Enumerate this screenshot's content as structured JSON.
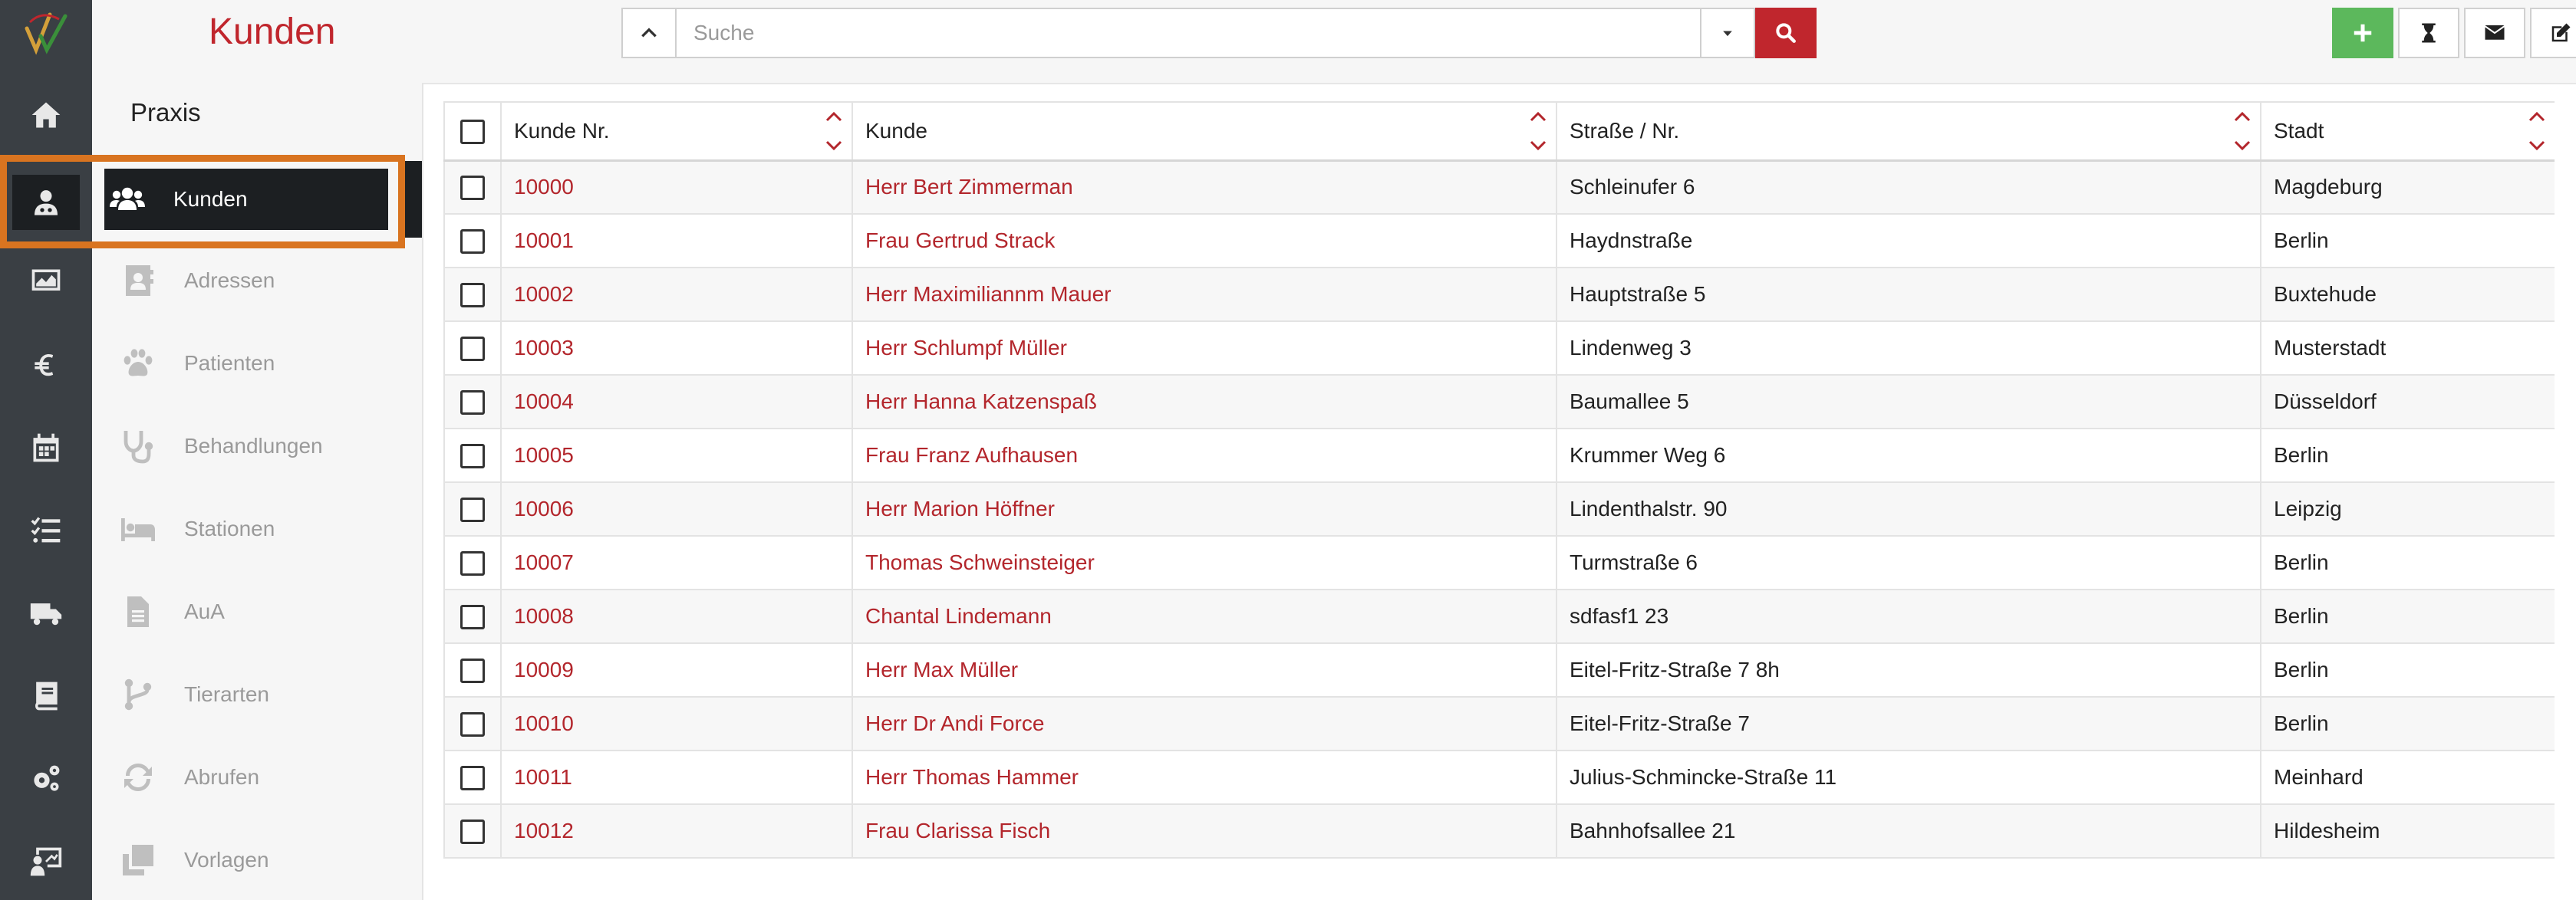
{
  "header": {
    "title": "Kunden",
    "search_placeholder": "Suche",
    "search_value": ""
  },
  "rail": {
    "items": [
      {
        "icon": "home-icon"
      },
      {
        "icon": "user-doctor-icon",
        "active": true
      },
      {
        "icon": "monitor-chart-icon"
      },
      {
        "icon": "euro-icon"
      },
      {
        "icon": "calendar-icon"
      },
      {
        "icon": "tasks-icon"
      },
      {
        "icon": "truck-icon"
      },
      {
        "icon": "book-icon"
      },
      {
        "icon": "gears-icon"
      },
      {
        "icon": "chalkboard-user-icon"
      }
    ]
  },
  "subnav": {
    "heading": "Praxis",
    "items": [
      {
        "label": "Kunden",
        "icon": "users-icon",
        "active": true
      },
      {
        "label": "Adressen",
        "icon": "address-book-icon"
      },
      {
        "label": "Patienten",
        "icon": "paw-icon"
      },
      {
        "label": "Behandlungen",
        "icon": "stethoscope-icon"
      },
      {
        "label": "Stationen",
        "icon": "bed-icon"
      },
      {
        "label": "AuA",
        "icon": "file-icon"
      },
      {
        "label": "Tierarten",
        "icon": "code-branch-icon"
      },
      {
        "label": "Abrufen",
        "icon": "sync-icon"
      },
      {
        "label": "Vorlagen",
        "icon": "copy-icon"
      }
    ]
  },
  "toolbar": {
    "buttons": [
      {
        "name": "add",
        "icon": "plus-icon",
        "color": "#5cb85c"
      },
      {
        "name": "hourglass",
        "icon": "hourglass-icon"
      },
      {
        "name": "mail",
        "icon": "envelope-icon"
      },
      {
        "name": "edit",
        "icon": "edit-icon"
      },
      {
        "name": "delete",
        "icon": "trash-icon",
        "color": "#d9534f"
      }
    ]
  },
  "table": {
    "columns": [
      "Kunde Nr.",
      "Kunde",
      "Straße / Nr.",
      "Stadt"
    ],
    "rows": [
      [
        "10000",
        "Herr Bert Zimmerman",
        "Schleinufer 6",
        "Magdeburg"
      ],
      [
        "10001",
        "Frau Gertrud Strack",
        "Haydnstraße",
        "Berlin"
      ],
      [
        "10002",
        "Herr Maximiliannm Mauer",
        "Hauptstraße 5",
        "Buxtehude"
      ],
      [
        "10003",
        "Herr Schlumpf Müller",
        "Lindenweg 3",
        "Musterstadt"
      ],
      [
        "10004",
        "Herr Hanna Katzenspaß",
        "Baumallee 5",
        "Düsseldorf"
      ],
      [
        "10005",
        "Frau Franz Aufhausen",
        "Krummer Weg 6",
        "Berlin"
      ],
      [
        "10006",
        "Herr Marion Höffner",
        "Lindenthalstr. 90",
        "Leipzig"
      ],
      [
        "10007",
        "Thomas Schweinsteiger",
        "Turmstraße 6",
        "Berlin"
      ],
      [
        "10008",
        "Chantal Lindemann",
        "sdfasf1 23",
        "Berlin"
      ],
      [
        "10009",
        "Herr Max Müller",
        "Eitel-Fritz-Straße 7 8h",
        "Berlin"
      ],
      [
        "10010",
        "Herr Dr Andi Force",
        "Eitel-Fritz-Straße 7",
        "Berlin"
      ],
      [
        "10011",
        "Herr Thomas Hammer",
        "Julius-Schmincke-Straße 11",
        "Meinhard"
      ],
      [
        "10012",
        "Frau Clarissa Fisch",
        "Bahnhofsallee 21",
        "Hildesheim"
      ]
    ]
  },
  "colors": {
    "accent": "#c0262d",
    "highlight": "#d97420",
    "rail": "#3a3f44"
  }
}
